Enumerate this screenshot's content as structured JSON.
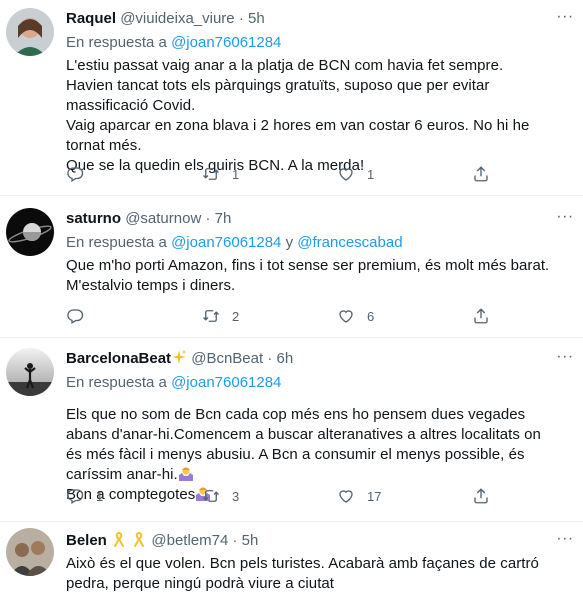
{
  "tweets": [
    {
      "name": "Raquel",
      "handle": "@viuideixa_viure",
      "dot": "·",
      "time": "5h",
      "reply_prefix": "En respuesta a",
      "reply_mentions": [
        "@joan76061284"
      ],
      "text_lines": [
        "L'estiu passat vaig anar a la platja de BCN com havia fet sempre. Havien tancat tots els pàrquings gratuïts, suposo que per evitar massificació Covid.",
        "Vaig aparcar en zona blava i 2 hores em van costar 6 euros. No hi he tornat més.",
        "Que se la quedin els guiris BCN. A la merda!"
      ],
      "replies": "",
      "retweets": "1",
      "likes": "1"
    },
    {
      "name": "saturno",
      "handle": "@saturnow",
      "dot": "·",
      "time": "7h",
      "reply_prefix": "En respuesta a",
      "reply_mentions": [
        "@joan76061284",
        "@francescabad"
      ],
      "reply_joiner": "y",
      "text_lines": [
        "Que m'ho porti Amazon, fins i tot sense ser premium, és molt més barat. M'estalvio temps i diners."
      ],
      "replies": "",
      "retweets": "2",
      "likes": "6"
    },
    {
      "name": "BarcelonaBeat",
      "handle": "@BcnBeat",
      "dot": "·",
      "time": "6h",
      "reply_prefix": "En respuesta a",
      "reply_mentions": [
        "@joan76061284"
      ],
      "text_lines": [
        "Els que no som de Bcn cada cop més ens ho pensem dues vegades abans d'anar-hi.Comencem a buscar alteranatives a altres localitats on és més fàcil i menys abusiu. A Bcn a consumir el menys possible, és caríssim anar-hi.",
        "Bcn a comptegotes"
      ],
      "replies": "1",
      "retweets": "3",
      "likes": "17"
    },
    {
      "name": "Belen",
      "handle": "@betlem74",
      "dot": "·",
      "time": "5h",
      "text_lines": [
        "Això és el que volen. Bcn pels turistes. Acabarà amb façanes de cartró pedra, perque ningú podrà viure a ciutat"
      ]
    }
  ],
  "colors": {
    "accent": "#1d9bf0",
    "secondary": "#536471",
    "text": "#0f1419",
    "divider": "#eff3f4"
  },
  "icons": [
    "reply-icon",
    "retweet-icon",
    "like-icon",
    "share-icon",
    "more-icon",
    "sparkles-emoji",
    "person-shrugging-emoji",
    "yellow-ribbon-emoji"
  ]
}
